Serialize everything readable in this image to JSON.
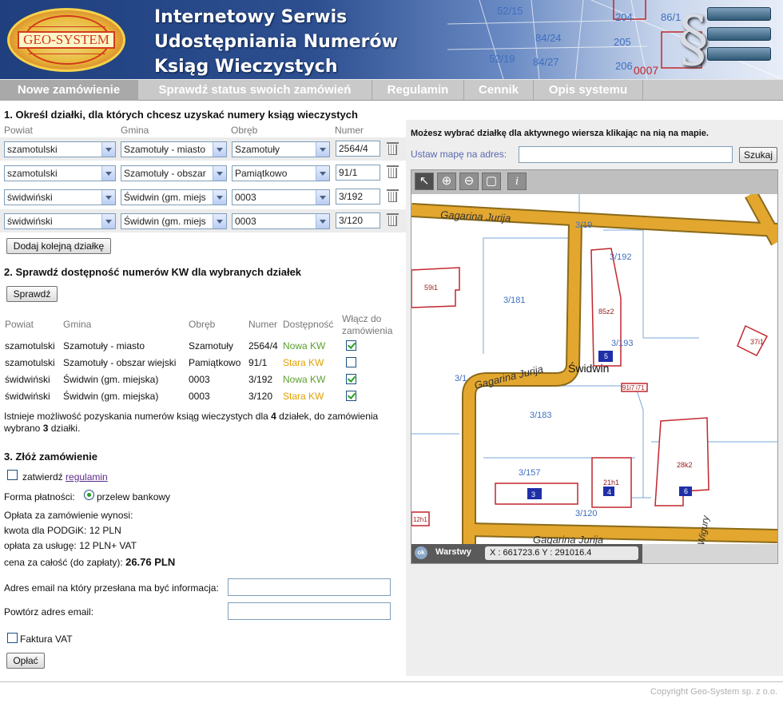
{
  "header": {
    "logo_text": "GEO-SYSTEM",
    "title_lines": [
      "Internetowy Serwis",
      "Udostępniania Numerów",
      "Ksiąg Wieczystych"
    ],
    "bg_map_labels": [
      "52/15",
      "204",
      "86/1",
      "84/24",
      "205",
      "52/19",
      "84/27",
      "206"
    ],
    "bg_red_label": "0007",
    "paragraph_symbol": "§"
  },
  "nav": {
    "tabs": [
      "Nowe zamówienie",
      "Sprawdź status swoich zamówień",
      "Regulamin",
      "Cennik",
      "Opis systemu"
    ],
    "active": 0
  },
  "step1": {
    "title": "1. Określ działki, dla których chcesz uzyskać numery ksiąg wieczystych",
    "headers": [
      "Powiat",
      "Gmina",
      "Obręb",
      "Numer"
    ],
    "rows": [
      {
        "powiat": "szamotulski",
        "gmina": "Szamotuły - miasto",
        "obreb": "Szamotuły",
        "numer": "2564/4"
      },
      {
        "powiat": "szamotulski",
        "gmina": "Szamotuły - obszar",
        "obreb": "Pamiątkowo",
        "numer": "91/1"
      },
      {
        "powiat": "świdwiński",
        "gmina": "Świdwin (gm. miejs",
        "obreb": "0003",
        "numer": "3/192"
      },
      {
        "powiat": "świdwiński",
        "gmina": "Świdwin (gm. miejs",
        "obreb": "0003",
        "numer": "3/120"
      }
    ],
    "add_button": "Dodaj kolejną działkę"
  },
  "step2": {
    "title": "2. Sprawdź dostępność numerów KW dla wybranych działek",
    "check_button": "Sprawdź",
    "headers": [
      "Powiat",
      "Gmina",
      "Obręb",
      "Numer",
      "Dostępność",
      "Włącz do",
      "zamówienia"
    ],
    "rows": [
      {
        "powiat": "szamotulski",
        "gmina": "Szamotuły - miasto",
        "obreb": "Szamotuły",
        "numer": "2564/4",
        "status": "Nowa KW",
        "color": "#5aa02c",
        "checked": true
      },
      {
        "powiat": "szamotulski",
        "gmina": "Szamotuły - obszar wiejski",
        "obreb": "Pamiątkowo",
        "numer": "91/1",
        "status": "Stara KW",
        "color": "#e0a000",
        "checked": false
      },
      {
        "powiat": "świdwiński",
        "gmina": "Świdwin (gm. miejska)",
        "obreb": "0003",
        "numer": "3/192",
        "status": "Nowa KW",
        "color": "#5aa02c",
        "checked": true
      },
      {
        "powiat": "świdwiński",
        "gmina": "Świdwin (gm. miejska)",
        "obreb": "0003",
        "numer": "3/120",
        "status": "Stara KW",
        "color": "#e0a000",
        "checked": true
      }
    ],
    "info_line1_a": "Istnieje możliwość pozyskania numerów ksiąg wieczystych dla ",
    "info_line1_b": "4",
    "info_line1_c": " działek, do zamówienia",
    "info_line2_a": "wybrano ",
    "info_line2_b": "3",
    "info_line2_c": " działki."
  },
  "step3": {
    "title": "3. Złóż zamówienie",
    "confirm_prefix": "zatwierdź ",
    "confirm_link": "regulamin",
    "payment_label": "Forma płatności:",
    "payment_option": "przelew bankowy",
    "fee_intro": "Opłata za zamówienie wynosi:",
    "fee_podgik": "kwota dla PODGiK: 12 PLN",
    "fee_service": "opłata za usługę: 12 PLN+ VAT",
    "total_label": "cena za całość (do zapłaty):",
    "total_value": "26.76 PLN",
    "email_label": "Adres email na który przesłana ma być informacja:",
    "email_repeat_label": "Powtórz adres email:",
    "invoice_label": "Faktura VAT",
    "pay_button": "Opłać"
  },
  "map_panel": {
    "hint": "Możesz wybrać działkę dla aktywnego wiersza klikając na nią na mapie.",
    "address_label": "Ustaw mapę na adres:",
    "address_value": "",
    "search_button": "Szukaj",
    "tools": [
      "pointer-icon",
      "zoom-in-icon",
      "zoom-out-icon",
      "full-extent-icon",
      "info-icon"
    ],
    "layers_label": "Warstwy",
    "layers_button": "ok",
    "coords": "X : 661723.6  Y : 291016.4",
    "map_labels": {
      "street_top": "Gagarina Jurija",
      "street_mid": "Gagarina Jurija",
      "street_bottom": "Gagarina Jurija",
      "street_right": "Wigury",
      "town": "Świdwin",
      "parcels": [
        "3/192",
        "3/181",
        "3/193",
        "3/183",
        "3/157",
        "3/120",
        "3/1",
        "3/19"
      ],
      "buildings": [
        "59i1",
        "85z2",
        "5",
        "37i1",
        "28k2",
        "6",
        "21h1",
        "4",
        "3",
        "91i7",
        "i71",
        "12h1"
      ]
    }
  },
  "footer": {
    "copyright": "Copyright Geo-System sp. z o.o."
  }
}
